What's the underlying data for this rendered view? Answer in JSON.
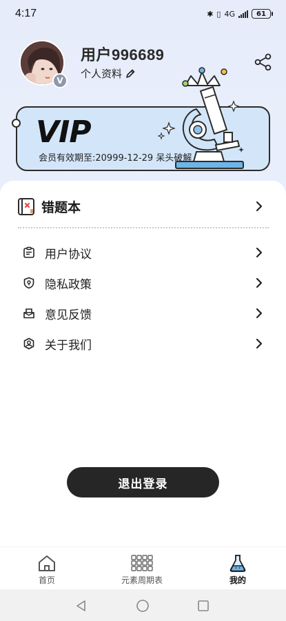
{
  "status_bar": {
    "time": "4:17",
    "network": "4G",
    "battery": "61"
  },
  "profile": {
    "username": "用户996689",
    "profile_link": "个人资料",
    "badge": "V"
  },
  "vip": {
    "logo_text": "VIP",
    "expire_text": "会员有效期至:20999-12-29 呆头破解"
  },
  "wrong_book": {
    "label": "错题本"
  },
  "menu": {
    "items": [
      {
        "label": "用户协议",
        "icon": "document-icon"
      },
      {
        "label": "隐私政策",
        "icon": "shield-icon"
      },
      {
        "label": "意见反馈",
        "icon": "feedback-icon"
      },
      {
        "label": "关于我们",
        "icon": "about-user-icon"
      }
    ]
  },
  "logout": {
    "label": "退出登录"
  },
  "tabbar": {
    "tabs": [
      {
        "label": "首页",
        "icon": "home-icon"
      },
      {
        "label": "元素周期表",
        "icon": "grid-icon"
      },
      {
        "label": "我的",
        "icon": "flask-icon"
      }
    ],
    "active_index": 2
  },
  "colors": {
    "accent_dark": "#262626",
    "vip_card_bg": "#d3e6f9",
    "header_bg": "#e9eef9"
  }
}
